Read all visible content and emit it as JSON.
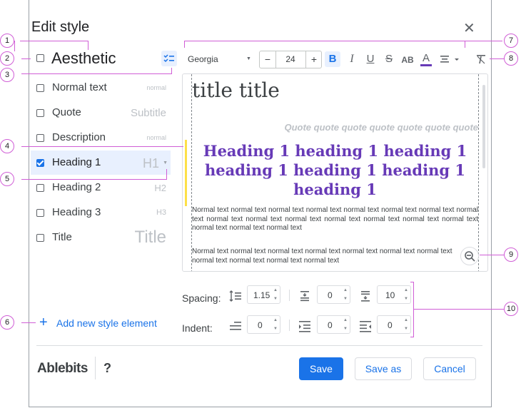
{
  "dialog": {
    "title": "Edit style",
    "close_icon": "close-icon"
  },
  "preset": {
    "name": "Aesthetic"
  },
  "styles": [
    {
      "label": "Normal text",
      "sample": "normal",
      "checked": false
    },
    {
      "label": "Quote",
      "sample": "Subtitle",
      "checked": false
    },
    {
      "label": "Description",
      "sample": "normal",
      "checked": false
    },
    {
      "label": "Heading 1",
      "sample": "H1",
      "checked": true
    },
    {
      "label": "Heading 2",
      "sample": "H2",
      "checked": false
    },
    {
      "label": "Heading 3",
      "sample": "H3",
      "checked": false
    },
    {
      "label": "Title",
      "sample": "Title",
      "checked": false
    }
  ],
  "add_element": "Add new style element",
  "toolbar": {
    "font": "Georgia",
    "size": "24",
    "minus": "−",
    "plus": "+",
    "bold": "B",
    "italic": "I",
    "underline": "U",
    "strike": "S",
    "caps": "AB",
    "color": "A",
    "accent_color": "#673ab7"
  },
  "preview": {
    "title": "title title",
    "quote": "Quote quote quote quote quote quote quote",
    "heading": "Heading 1 heading 1 heading 1 heading 1 heading 1 heading 1 heading 1",
    "normal1": "Normal text normal text normal text normal text normal text normal text normal text normal text normal text normal text normal text normal text normal text normal text normal text normal text normal text normal text",
    "normal2": "Normal text normal text normal text normal text normal text normal text normal text normal text normal text normal text normal text"
  },
  "spacing": {
    "label": "Spacing:",
    "line": "1.15",
    "before": "0",
    "after": "10"
  },
  "indent": {
    "label": "Indent:",
    "first": "0",
    "left": "0",
    "right": "0"
  },
  "footer": {
    "brand": "Ablebits",
    "help": "?",
    "save": "Save",
    "save_as": "Save as",
    "cancel": "Cancel"
  },
  "callouts": [
    "1",
    "2",
    "3",
    "4",
    "5",
    "6",
    "7",
    "8",
    "9",
    "10"
  ]
}
